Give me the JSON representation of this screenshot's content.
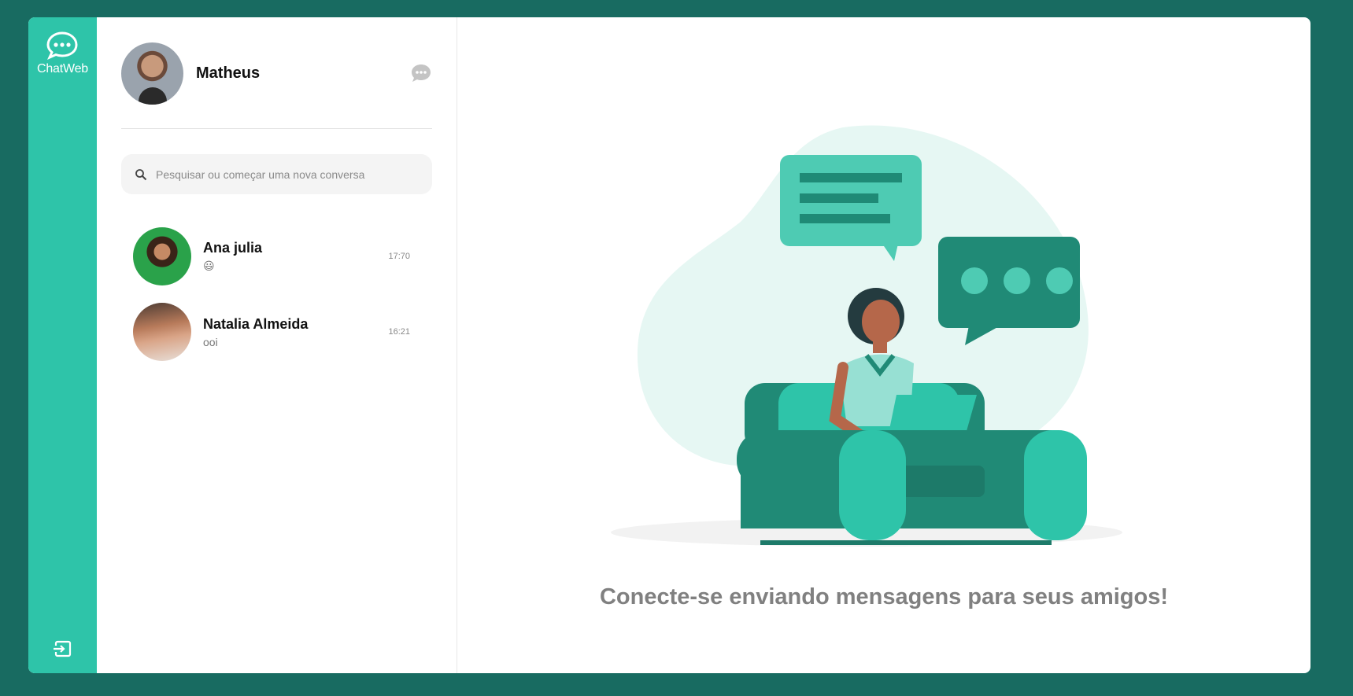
{
  "app": {
    "brand_label": "ChatWeb"
  },
  "profile": {
    "name": "Matheus"
  },
  "search": {
    "placeholder": "Pesquisar ou começar uma nova conversa"
  },
  "chats": [
    {
      "name": "Ana julia",
      "last_message": "😃",
      "time": "17:70"
    },
    {
      "name": "Natalia Almeida",
      "last_message": "ooi",
      "time": "16:21"
    }
  ],
  "main": {
    "empty_message": "Conecte-se enviando mensagens para seus amigos!"
  },
  "icons": {
    "brand": "chat-bubble-icon",
    "logout": "logout-icon",
    "new_chat": "chat-bubble-icon",
    "search": "search-icon"
  },
  "colors": {
    "background": "#186b61",
    "accent": "#2ec4a9",
    "accent_dark": "#208a76",
    "bubble_light": "#4ecbb3",
    "blob": "#e6f7f3"
  }
}
